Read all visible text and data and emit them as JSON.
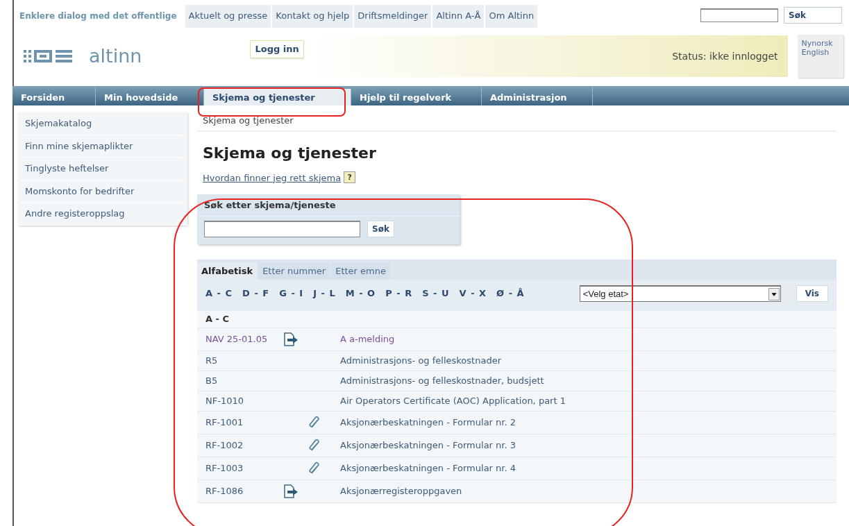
{
  "tagline": "Enklere dialog med det offentlige",
  "top_links": [
    "Aktuelt og presse",
    "Kontakt og hjelp",
    "Driftsmeldinger",
    "Altinn A-Å",
    "Om Altinn"
  ],
  "top_search": {
    "button": "Søk"
  },
  "logo": {
    "text": "altinn"
  },
  "login_button": "Logg inn",
  "status": "Status: ikke innlogget",
  "languages": [
    "Nynorsk",
    "English"
  ],
  "main_nav": [
    {
      "label": "Forsiden",
      "selected": false
    },
    {
      "label": "Min hovedside",
      "selected": false
    },
    {
      "label": "Skjema og tjenester",
      "selected": true
    },
    {
      "label": "Hjelp til regelverk",
      "selected": false
    },
    {
      "label": "Administrasjon",
      "selected": false
    }
  ],
  "sidebar": {
    "items": [
      "Skjemakatalog",
      "Finn mine skjemaplikter",
      "Tinglyste heftelser",
      "Momskonto for bedrifter",
      "Andre registeroppslag"
    ]
  },
  "breadcrumb": "Skjema og tjenester",
  "heading": "Skjema og tjenester",
  "help_link": "Hvordan finner jeg rett skjema",
  "help_icon": "?",
  "search_panel": {
    "title": "Søk etter skjema/tjeneste",
    "button": "Søk"
  },
  "tabs": [
    {
      "label": "Alfabetisk",
      "selected": true
    },
    {
      "label": "Etter nummer",
      "selected": false
    },
    {
      "label": "Etter emne",
      "selected": false
    }
  ],
  "letter_ranges": [
    "A - C",
    "D - F",
    "G - I",
    "J - L",
    "M - O",
    "P - R",
    "S - U",
    "V - X",
    "Ø - Å"
  ],
  "agency_select": {
    "value": "<Velg etat>",
    "button": "Vis"
  },
  "group_heading": "A - C",
  "rows": [
    {
      "code": "NAV 25-01.05",
      "kind": "form",
      "title": "A a-melding",
      "visited": true
    },
    {
      "code": "R5",
      "kind": "plain",
      "title": "Administrasjons- og felleskostnader",
      "visited": false
    },
    {
      "code": "B5",
      "kind": "plain",
      "title": "Administrasjons- og felleskostnader, budsjett",
      "visited": false
    },
    {
      "code": "NF-1010",
      "kind": "plain",
      "title": "Air Operators Certificate (AOC) Application, part 1",
      "visited": false
    },
    {
      "code": "RF-1001",
      "kind": "attachment",
      "title": "Aksjonærbeskatningen - Formular nr. 2",
      "visited": false
    },
    {
      "code": "RF-1002",
      "kind": "attachment",
      "title": "Aksjonærbeskatningen - Formular nr. 3",
      "visited": false
    },
    {
      "code": "RF-1003",
      "kind": "attachment",
      "title": "Aksjonærbeskatningen - Formular nr. 4",
      "visited": false
    },
    {
      "code": "RF-1086",
      "kind": "form",
      "title": "Aksjonærregisteroppgaven",
      "visited": false
    }
  ]
}
